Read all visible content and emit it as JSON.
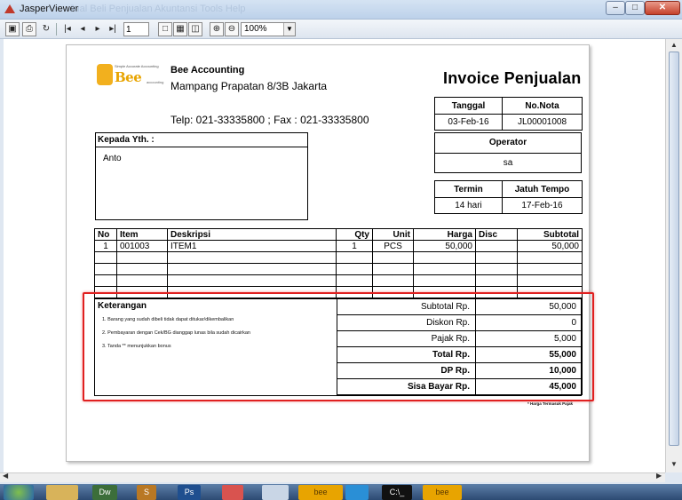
{
  "window": {
    "title": "JasperViewer",
    "ghost_menu": "Jual Beli   Penjualan   Akuntansi   Tools   Help"
  },
  "toolbar": {
    "page_number": "1",
    "zoom": "100%"
  },
  "company": {
    "logo_text": "Bee",
    "logo_tagline": "Simple Accurate Accounting",
    "logo_sub": "accounting",
    "name": "Bee Accounting",
    "address": "Mampang Prapatan 8/3B Jakarta",
    "phone": "Telp: 021-33335800 ; Fax : 021-33335800"
  },
  "invoice": {
    "title": "Invoice Penjualan",
    "labels": {
      "tanggal": "Tanggal",
      "no_nota": "No.Nota",
      "operator": "Operator",
      "termin": "Termin",
      "jatuh_tempo": "Jatuh Tempo",
      "kepada": "Kepada Yth.  :"
    },
    "tanggal": "03-Feb-16",
    "no_nota": "JL00001008",
    "operator": "sa",
    "termin": "14 hari",
    "jatuh_tempo": "17-Feb-16",
    "kepada": "Anto"
  },
  "items": {
    "headers": [
      "No",
      "Item",
      "Deskripsi",
      "Qty",
      "Unit",
      "Harga",
      "Disc",
      "Subtotal"
    ],
    "rows": [
      [
        "1",
        "001003",
        "ITEM1",
        "1",
        "PCS",
        "50,000",
        "",
        "50,000"
      ]
    ]
  },
  "keterangan": {
    "title": "Keterangan",
    "notes": [
      "1. Barang yang sudah dibeli tidak dapat ditukar/dikembalikan",
      "2. Pembayaran dengan Cek/BG dianggap lunas bila sudah dicairkan",
      "3. Tanda ** menunjukkan bonus"
    ]
  },
  "summary": [
    {
      "label": "Subtotal Rp.",
      "value": "50,000",
      "bold": false
    },
    {
      "label": "Diskon Rp.",
      "value": "0",
      "bold": false
    },
    {
      "label": "Pajak Rp.",
      "value": "5,000",
      "bold": false
    },
    {
      "label": "Total Rp.",
      "value": "55,000",
      "bold": true
    },
    {
      "label": "DP Rp.",
      "value": "10,000",
      "bold": true
    },
    {
      "label": "Sisa Bayar Rp.",
      "value": "45,000",
      "bold": true
    }
  ],
  "footnote": "* Harga Termasuk Pajak",
  "taskbar": {
    "items": [
      "",
      "",
      "Dw",
      "S",
      "Ps",
      "",
      "",
      "bee",
      "",
      "C:\\_",
      "bee"
    ]
  }
}
